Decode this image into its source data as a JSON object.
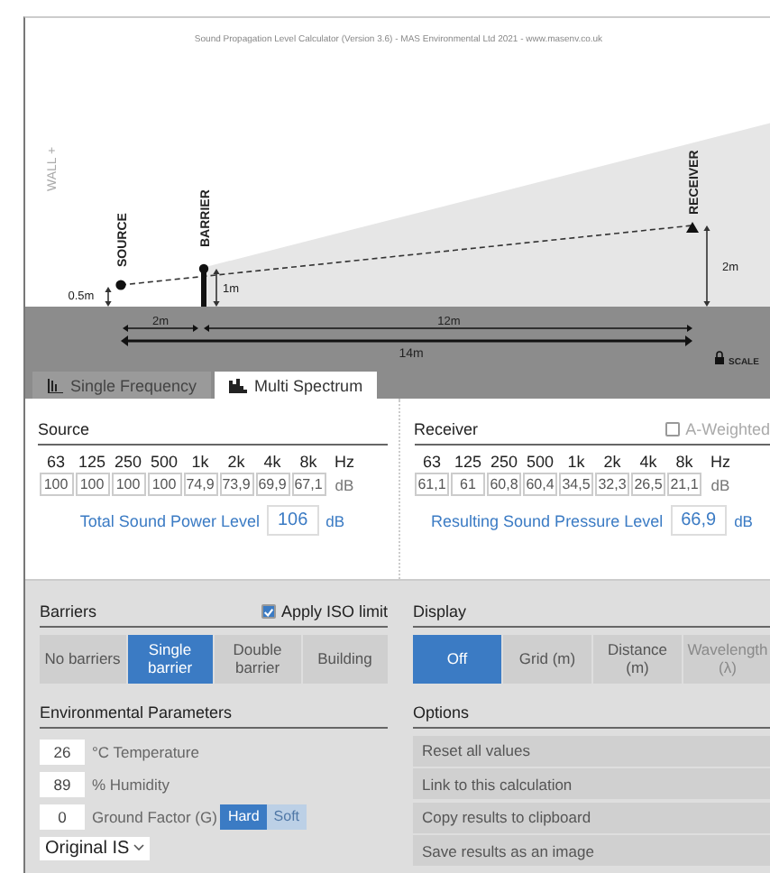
{
  "header": {
    "title": "Sound Propagation Level Calculator (Version 3.6) - MAS Environmental Ltd 2021 - www.masenv.co.uk"
  },
  "diagram": {
    "wall": "WALL +",
    "source": "SOURCE",
    "barrier": "BARRIER",
    "receiver": "RECEIVER",
    "source_height": "0.5m",
    "barrier_height": "1m",
    "receiver_height": "2m",
    "distances": [
      "2m",
      "12m"
    ],
    "total_distance": "14m",
    "scale": "SCALE"
  },
  "tabs": [
    {
      "label": "Single Frequency",
      "selected": false,
      "kind": "single"
    },
    {
      "label": "Multi Spectrum",
      "selected": true,
      "kind": "multi"
    }
  ],
  "source": {
    "title": "Source",
    "frequencies": [
      "63",
      "125",
      "250",
      "500",
      "1k",
      "2k",
      "4k",
      "8k"
    ],
    "hz": "Hz",
    "values": [
      "100",
      "100",
      "100",
      "100",
      "74,9",
      "73,9",
      "69,9",
      "67,1"
    ],
    "db": "dB",
    "total_label": "Total Sound Power Level",
    "total_value": "106",
    "total_unit": "dB"
  },
  "receiver": {
    "title": "Receiver",
    "a_weighted": {
      "label": "A-Weighted",
      "checked": false
    },
    "frequencies": [
      "63",
      "125",
      "250",
      "500",
      "1k",
      "2k",
      "4k",
      "8k"
    ],
    "hz": "Hz",
    "values": [
      "61,1",
      "61",
      "60,8",
      "60,4",
      "34,5",
      "32,3",
      "26,5",
      "21,1"
    ],
    "db": "dB",
    "total_label": "Resulting Sound Pressure Level",
    "total_value": "66,9",
    "total_unit": "dB"
  },
  "barriers": {
    "title": "Barriers",
    "iso_limit": {
      "label": "Apply ISO limit",
      "checked": true
    },
    "options": [
      {
        "label": "No barriers",
        "selected": false
      },
      {
        "label": "Single barrier",
        "selected": true
      },
      {
        "label": "Double barrier",
        "selected": false
      },
      {
        "label": "Building",
        "selected": false
      }
    ]
  },
  "display": {
    "title": "Display",
    "options": [
      {
        "label": "Off",
        "selected": true,
        "disabled": false
      },
      {
        "label": "Grid (m)",
        "selected": false,
        "disabled": false
      },
      {
        "label": "Distance (m)",
        "selected": false,
        "disabled": false
      },
      {
        "label": "Wavelength (λ)",
        "selected": false,
        "disabled": true
      }
    ]
  },
  "environment": {
    "title": "Environmental Parameters",
    "temperature": {
      "value": "26",
      "label": "°C Temperature"
    },
    "humidity": {
      "value": "89",
      "label": "% Humidity"
    },
    "ground": {
      "value": "0",
      "label": "Ground Factor (G)",
      "options": [
        {
          "label": "Hard",
          "selected": true
        },
        {
          "label": "Soft",
          "selected": false
        }
      ]
    },
    "standard": "Original IS"
  },
  "options": {
    "title": "Options",
    "items": [
      "Reset all values",
      "Link to this calculation",
      "Copy results to clipboard",
      "Save results as an image"
    ]
  }
}
